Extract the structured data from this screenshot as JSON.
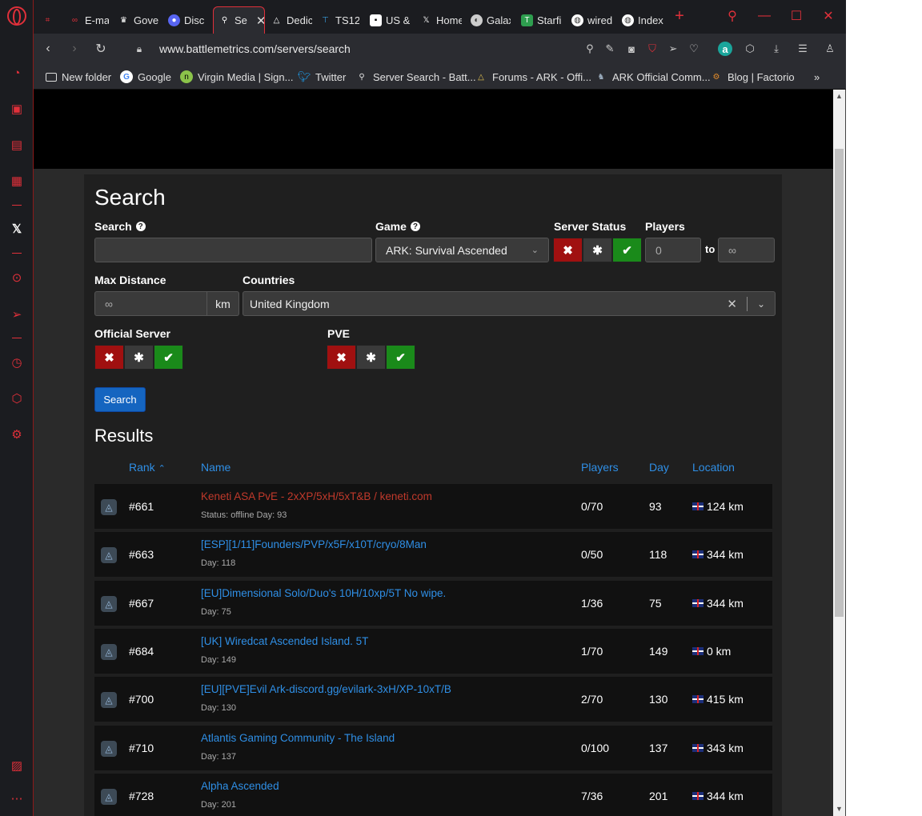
{
  "browser": {
    "tabs": [
      {
        "label": "",
        "icon": "gamepad-icon"
      },
      {
        "label": "E-ma",
        "icon": "mail-icon"
      },
      {
        "label": "Gove",
        "icon": "crown-icon"
      },
      {
        "label": "Disc",
        "icon": "discord-icon"
      },
      {
        "label": "Se",
        "icon": "search-icon",
        "active": true
      },
      {
        "label": "Dedic",
        "icon": "ark-icon"
      },
      {
        "label": "TS12",
        "icon": "ts-icon"
      },
      {
        "label": "US &",
        "icon": "us-icon"
      },
      {
        "label": "Home",
        "icon": "x-icon"
      },
      {
        "label": "Galax",
        "icon": "galaxy-icon"
      },
      {
        "label": "Starfi",
        "icon": "starfield-icon"
      },
      {
        "label": "wired",
        "icon": "globe-icon"
      },
      {
        "label": "Index",
        "icon": "globe-icon"
      }
    ],
    "url": "www.battlemetrics.com/servers/search",
    "bookmarks": [
      {
        "label": "New folder",
        "icon": "folder-icon"
      },
      {
        "label": "Google",
        "icon": "google-icon"
      },
      {
        "label": "Virgin Media | Sign...",
        "icon": "virgin-icon"
      },
      {
        "label": "Twitter",
        "icon": "twitter-icon"
      },
      {
        "label": "Server Search - Batt...",
        "icon": "search-icon"
      },
      {
        "label": "Forums - ARK - Offi...",
        "icon": "ark-icon"
      },
      {
        "label": "ARK Official Comm...",
        "icon": "ark-community-icon"
      },
      {
        "label": "Blog | Factorio",
        "icon": "factorio-icon"
      }
    ]
  },
  "search": {
    "title": "Search",
    "search_label": "Search",
    "search_value": "",
    "game_label": "Game",
    "game_value": "ARK: Survival Ascended",
    "status_label": "Server Status",
    "players_label": "Players",
    "players_min_placeholder": "0",
    "players_to": "to",
    "players_max_placeholder": "∞",
    "max_distance_label": "Max Distance",
    "max_distance_placeholder": "∞",
    "distance_unit": "km",
    "countries_label": "Countries",
    "countries_value": "United Kingdom",
    "official_label": "Official Server",
    "pve_label": "PVE",
    "tri_no": "✖",
    "tri_any": "✱",
    "tri_yes": "✔",
    "search_button": "Search"
  },
  "results": {
    "title": "Results",
    "columns": {
      "rank": "Rank",
      "name": "Name",
      "players": "Players",
      "day": "Day",
      "location": "Location"
    },
    "rows": [
      {
        "rank": "#661",
        "name": "Keneti ASA PvE - 2xXP/5xH/5xT&B / keneti.com",
        "sub": "Status: offline  Day: 93",
        "players": "0/70",
        "day": "93",
        "location": "124 km",
        "offline": true
      },
      {
        "rank": "#663",
        "name": "[ESP][1/11]Founders/PVP/x5F/x10T/cryo/8Man",
        "sub": "Day: 118",
        "players": "0/50",
        "day": "118",
        "location": "344 km"
      },
      {
        "rank": "#667",
        "name": "[EU]Dimensional Solo/Duo's 10H/10xp/5T No wipe.",
        "sub": "Day: 75",
        "players": "1/36",
        "day": "75",
        "location": "344 km"
      },
      {
        "rank": "#684",
        "name": "[UK] Wiredcat Ascended Island. 5T",
        "sub": "Day: 149",
        "players": "1/70",
        "day": "149",
        "location": "0 km"
      },
      {
        "rank": "#700",
        "name": "[EU][PVE]Evil Ark-discord.gg/evilark-3xH/XP-10xT/B",
        "sub": "Day: 130",
        "players": "2/70",
        "day": "130",
        "location": "415 km"
      },
      {
        "rank": "#710",
        "name": "Atlantis Gaming Community - The Island",
        "sub": "Day: 137",
        "players": "0/100",
        "day": "137",
        "location": "343 km"
      },
      {
        "rank": "#728",
        "name": "Alpha Ascended",
        "sub": "Day: 201",
        "players": "7/36",
        "day": "201",
        "location": "344 km"
      }
    ]
  }
}
